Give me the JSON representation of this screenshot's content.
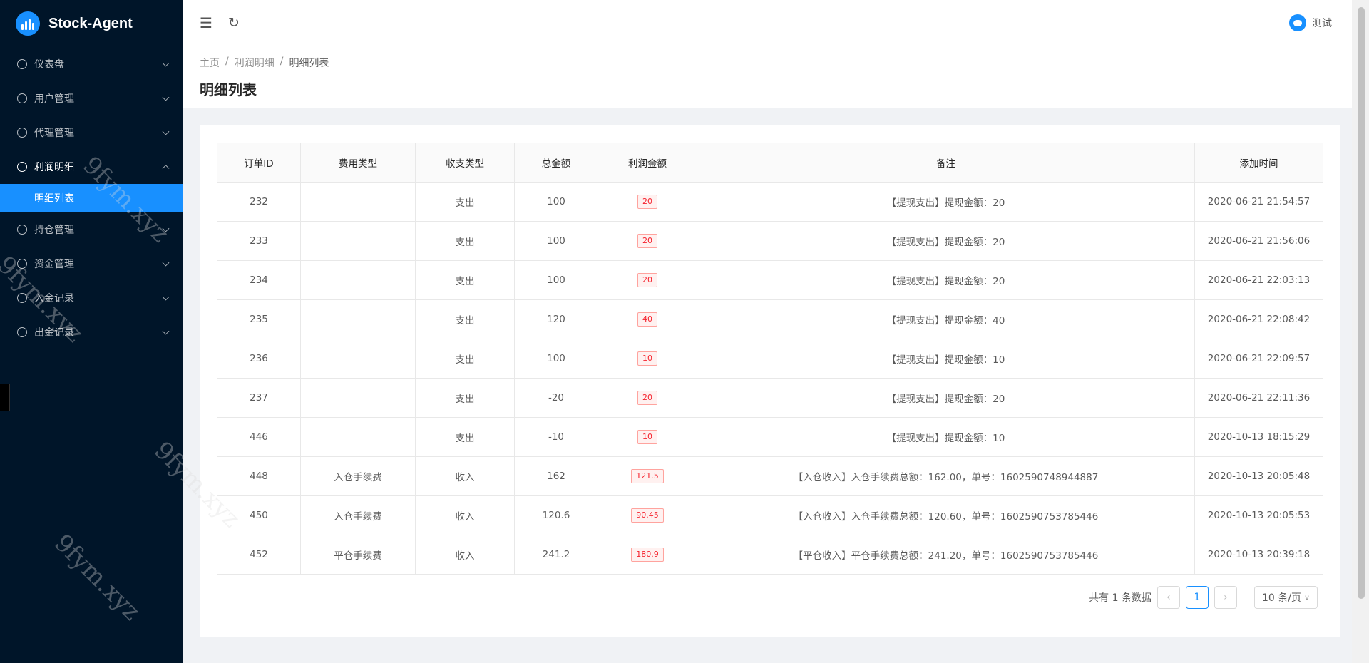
{
  "app": {
    "title": "Stock-Agent"
  },
  "sidebar": {
    "items": [
      {
        "label": "仪表盘",
        "icon": "dashboard-icon"
      },
      {
        "label": "用户管理",
        "icon": "user-icon"
      },
      {
        "label": "代理管理",
        "icon": "agent-icon"
      },
      {
        "label": "利润明细",
        "icon": "profit-icon",
        "open": true
      },
      {
        "label": "持仓管理",
        "icon": "position-icon"
      },
      {
        "label": "资金管理",
        "icon": "fund-icon"
      },
      {
        "label": "入金记录",
        "icon": "deposit-icon"
      },
      {
        "label": "出金记录",
        "icon": "withdraw-icon"
      }
    ],
    "submenu_active": "明细列表"
  },
  "header": {
    "user_name": "测试",
    "collapse_icon": "menu-fold-icon",
    "refresh_icon": "reload-icon"
  },
  "breadcrumb": [
    "主页",
    "利润明细",
    "明细列表"
  ],
  "page_title": "明细列表",
  "table": {
    "columns": [
      "订单ID",
      "费用类型",
      "收支类型",
      "总金额",
      "利润金额",
      "备注",
      "添加时间"
    ],
    "rows": [
      [
        "232",
        "",
        "支出",
        "100",
        "20",
        "【提现支出】提现金额：20",
        "2020-06-21 21:54:57"
      ],
      [
        "233",
        "",
        "支出",
        "100",
        "20",
        "【提现支出】提现金额：20",
        "2020-06-21 21:56:06"
      ],
      [
        "234",
        "",
        "支出",
        "100",
        "20",
        "【提现支出】提现金额：20",
        "2020-06-21 22:03:13"
      ],
      [
        "235",
        "",
        "支出",
        "120",
        "40",
        "【提现支出】提现金额：40",
        "2020-06-21 22:08:42"
      ],
      [
        "236",
        "",
        "支出",
        "100",
        "10",
        "【提现支出】提现金额：10",
        "2020-06-21 22:09:57"
      ],
      [
        "237",
        "",
        "支出",
        "-20",
        "20",
        "【提现支出】提现金额：20",
        "2020-06-21 22:11:36"
      ],
      [
        "446",
        "",
        "支出",
        "-10",
        "10",
        "【提现支出】提现金额：10",
        "2020-10-13 18:15:29"
      ],
      [
        "448",
        "入仓手续费",
        "收入",
        "162",
        "121.5",
        "【入仓收入】入仓手续费总额：162.00，单号：1602590748944887",
        "2020-10-13 20:05:48"
      ],
      [
        "450",
        "入仓手续费",
        "收入",
        "120.6",
        "90.45",
        "【入仓收入】入仓手续费总额：120.60，单号：1602590753785446",
        "2020-10-13 20:05:53"
      ],
      [
        "452",
        "平仓手续费",
        "收入",
        "241.2",
        "180.9",
        "【平仓收入】平仓手续费总额：241.20，单号：1602590753785446",
        "2020-10-13 20:39:18"
      ]
    ]
  },
  "pagination": {
    "total_text": "共有 1 条数据",
    "current_page": "1",
    "page_size": "10 条/页"
  },
  "watermark": "9fym.xyz",
  "colors": {
    "sidebar_bg": "#001529",
    "accent": "#1890ff",
    "tag_red": "#f5222d"
  }
}
